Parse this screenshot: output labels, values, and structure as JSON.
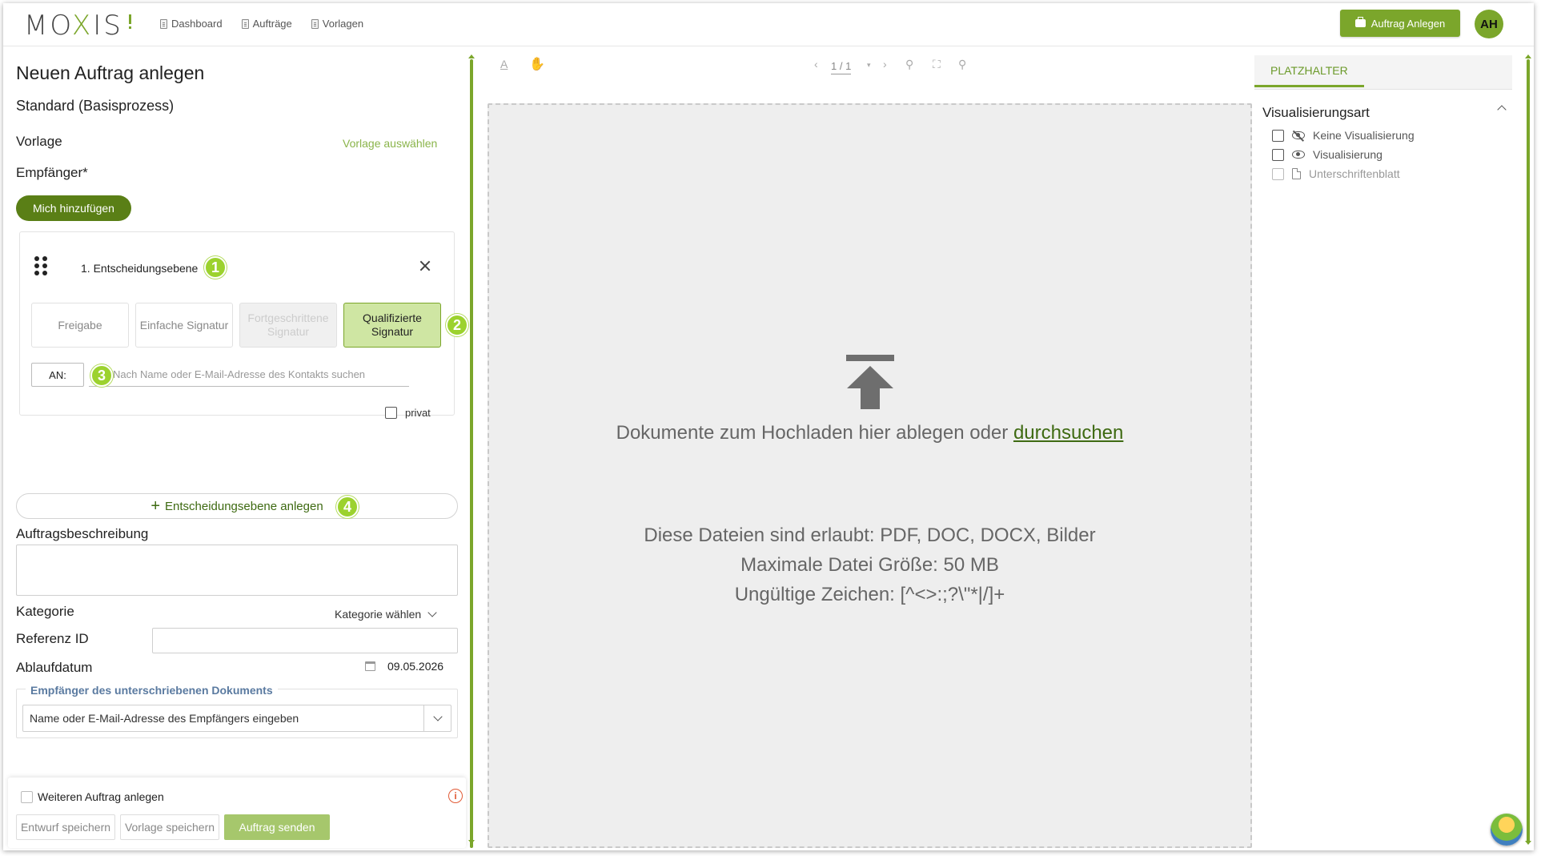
{
  "header": {
    "logo_text": "MOXIS",
    "nav": [
      {
        "label": "Dashboard"
      },
      {
        "label": "Aufträge"
      },
      {
        "label": "Vorlagen"
      }
    ],
    "new_order_button": "Auftrag Anlegen",
    "avatar_initials": "AH"
  },
  "form": {
    "title": "Neuen Auftrag anlegen",
    "process": "Standard (Basisprozess)",
    "template_label": "Vorlage",
    "template_link": "Vorlage auswählen",
    "recipients_label": "Empfänger*",
    "add_me_button": "Mich hinzufügen",
    "level": {
      "title": "1. Entscheidungsebene",
      "signature_options": [
        {
          "label": "Freigabe",
          "state": "normal"
        },
        {
          "label": "Einfache Signatur",
          "state": "normal"
        },
        {
          "label": "Fortgeschrittene Signatur",
          "state": "disabled"
        },
        {
          "label": "Qualifizierte Signatur",
          "state": "selected"
        }
      ],
      "an_label": "AN:",
      "contact_placeholder": "Nach Name oder E-Mail-Adresse des Kontakts suchen",
      "private_label": "privat"
    },
    "badges": [
      "1",
      "2",
      "3",
      "4"
    ],
    "add_level_button": "Entscheidungsebene anlegen",
    "description_label": "Auftragsbeschreibung",
    "category_label": "Kategorie",
    "category_select": "Kategorie wählen",
    "reference_label": "Referenz ID",
    "expiry_label": "Ablaufdatum",
    "expiry_value": "09.05.2026",
    "signed_recipient_legend": "Empfänger des unterschriebenen Dokuments",
    "signed_recipient_placeholder": "Name oder E-Mail-Adresse des Empfängers eingeben"
  },
  "footer": {
    "another_order": "Weiteren Auftrag anlegen",
    "save_draft": "Entwurf speichern",
    "save_template": "Vorlage speichern",
    "send_order": "Auftrag senden"
  },
  "viewer": {
    "page_indicator": "1 / 1",
    "drop_text": "Dokumente zum Hochladen hier ablegen oder",
    "browse_link": "durchsuchen",
    "allowed_files": "Diese Dateien sind erlaubt: PDF, DOC, DOCX, Bilder",
    "max_size": "Maximale Datei Größe: 50 MB",
    "invalid_chars": "Ungültige Zeichen: [^<>:;?\\\"*|/]+"
  },
  "placeholder_panel": {
    "tab": "PLATZHALTER",
    "section_title": "Visualisierungsart",
    "options": [
      {
        "label": "Keine Visualisierung",
        "icon": "eye-slash-icon"
      },
      {
        "label": "Visualisierung",
        "icon": "eye-icon"
      },
      {
        "label": "Unterschriftenblatt",
        "icon": "document-icon"
      }
    ]
  },
  "colors": {
    "accent": "#7ba62b",
    "accent_dark": "#5a7f16",
    "badge": "#9cd22e",
    "dropzone": "#eeeeee"
  }
}
